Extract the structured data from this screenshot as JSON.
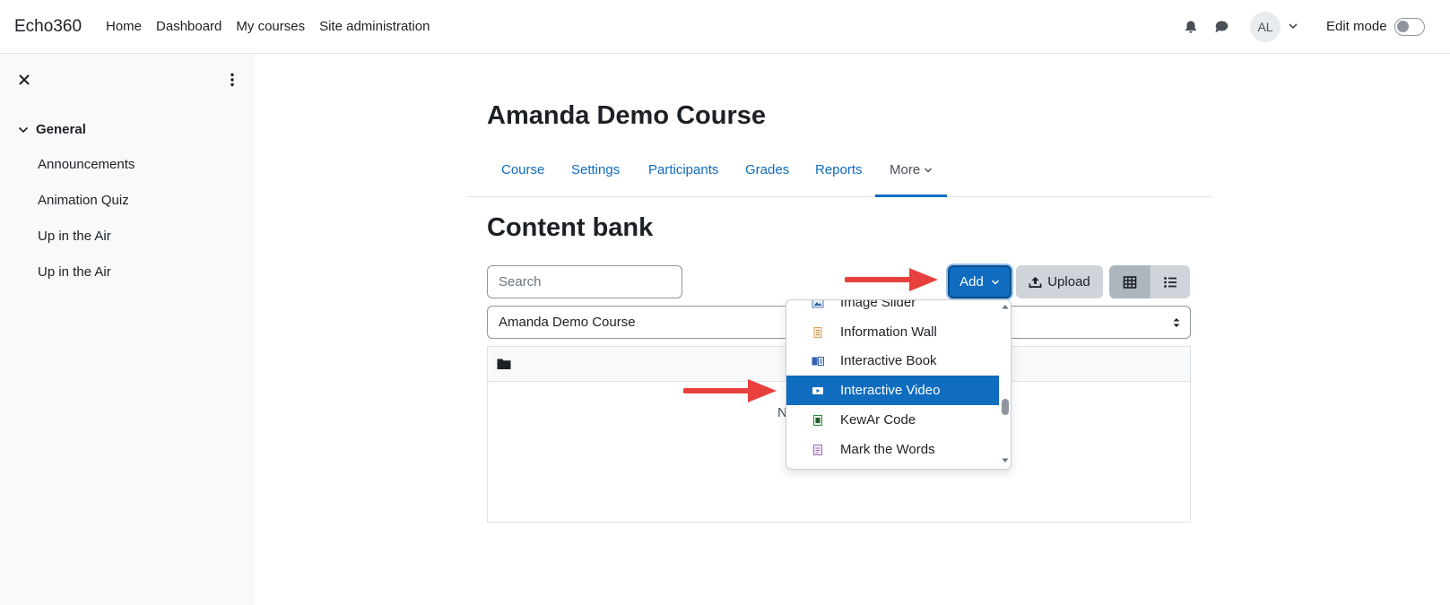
{
  "navbar": {
    "brand": "Echo360",
    "links": [
      "Home",
      "Dashboard",
      "My courses",
      "Site administration"
    ],
    "avatar_initials": "AL",
    "edit_mode_label": "Edit mode",
    "edit_mode_on": false
  },
  "drawer": {
    "section_title": "General",
    "items": [
      "Announcements",
      "Animation Quiz",
      "Up in the Air",
      "Up in the Air"
    ]
  },
  "course": {
    "title": "Amanda Demo Course",
    "tabs": [
      "Course",
      "Settings",
      "Participants",
      "Grades",
      "Reports"
    ],
    "more_label": "More"
  },
  "content_bank": {
    "title": "Content bank",
    "search_placeholder": "Search",
    "add_label": "Add",
    "upload_label": "Upload",
    "context_selected": "Amanda Demo Course",
    "empty_text_visible": "N"
  },
  "add_menu": {
    "items": [
      {
        "label": "Image Slider",
        "icon": "image-slider-icon",
        "active": false
      },
      {
        "label": "Information Wall",
        "icon": "information-wall-icon",
        "active": false
      },
      {
        "label": "Interactive Book",
        "icon": "interactive-book-icon",
        "active": false
      },
      {
        "label": "Interactive Video",
        "icon": "interactive-video-icon",
        "active": true
      },
      {
        "label": "KewAr Code",
        "icon": "qr-code-icon",
        "active": false
      },
      {
        "label": "Mark the Words",
        "icon": "mark-the-words-icon",
        "active": false
      }
    ]
  },
  "colors": {
    "primary": "#0f6cbf",
    "annotation_arrow": "#e8403d"
  }
}
